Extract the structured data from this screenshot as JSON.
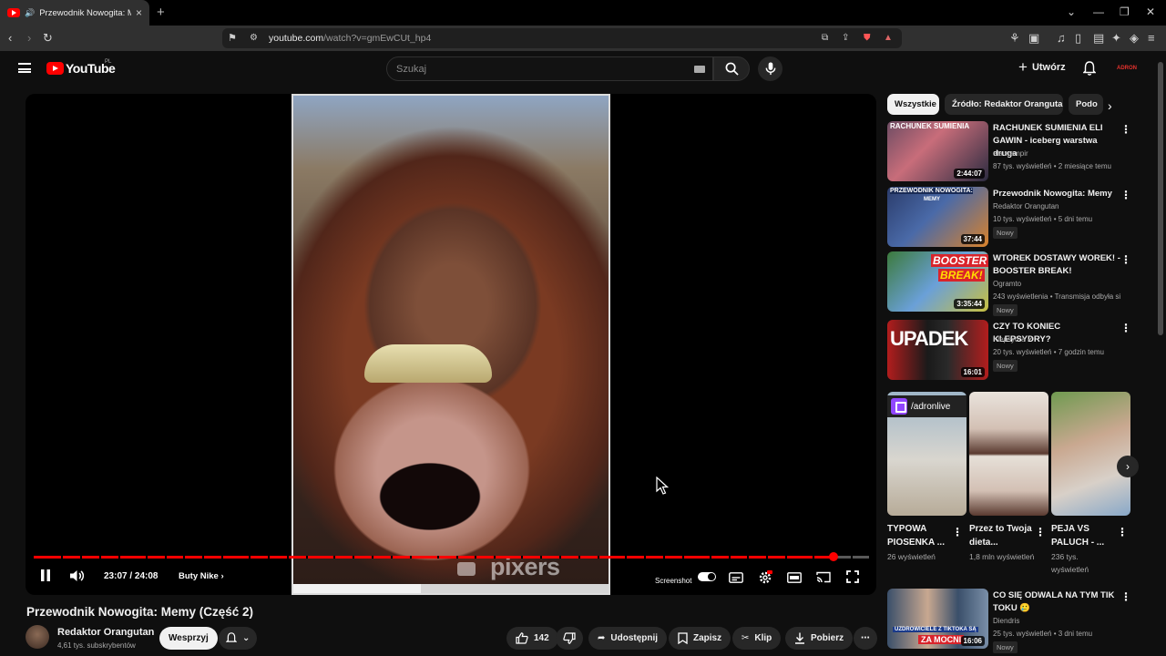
{
  "browser": {
    "tab_title": "Przewodnik Nowogita: Memy",
    "url_host": "youtube.com",
    "url_path": "/watch?v=gmEwCUt_hp4"
  },
  "header": {
    "logo_text": "YouTube",
    "logo_region": "PL",
    "search_placeholder": "Szukaj",
    "create_label": "Utwórz",
    "avatar_text": "ADRON"
  },
  "player": {
    "time": "23:07 / 24:08",
    "progress": 0.958,
    "chapter_label": "Buty Nike",
    "watermark": "pixers",
    "screenshot_label": "Screenshot",
    "accent_color": "#ff0000"
  },
  "video": {
    "title": "Przewodnik Nowogita: Memy (Część 2)",
    "channel": "Redaktor Orangutan",
    "subscribers": "4,61 tys. subskrybentów",
    "support_label": "Wesprzyj",
    "likes": "142",
    "share_label": "Udostępnij",
    "save_label": "Zapisz",
    "clip_label": "Klip",
    "download_label": "Pobierz"
  },
  "sidebar": {
    "chips": [
      "Wszystkie",
      "Źródło: Redaktor Orangutan",
      "Podo"
    ],
    "recommendations": [
      {
        "title": "RACHUNEK SUMIENIA ELI GAWIN - iceberg warstwa druga",
        "channel": "ela wampir",
        "meta": "87 tys. wyświetleń • 2 miesiące temu",
        "duration": "2:44:07",
        "badge": ""
      },
      {
        "title": "Przewodnik Nowogita: Memy",
        "channel": "Redaktor Orangutan",
        "meta": "10 tys. wyświetleń • 5 dni temu",
        "duration": "37:44",
        "badge": "Nowy"
      },
      {
        "title": "WTOREK DOSTAWY WOREK! - BOOSTER BREAK!",
        "channel": "Ogramto",
        "meta": "243 wyświetlenia • Transmisja odbyła się",
        "duration": "3:35:44",
        "badge": "Nowy"
      },
      {
        "title": "CZY TO KONIEC KLEPSYDRY?",
        "channel": "Klepsydra ✔",
        "meta": "20 tys. wyświetleń • 7 godzin temu",
        "duration": "16:01",
        "badge": "Nowy"
      }
    ],
    "shorts": [
      {
        "title": "TYPOWA PIOSENKA ...",
        "views": "26 wyświetleń",
        "tag": "/adronlive"
      },
      {
        "title": "Przez to Twoja dieta...",
        "views": "1,8 mln wyświetleń"
      },
      {
        "title": "PEJA VS PALUCH - ...",
        "views": "236 tys. wyświetleń"
      }
    ],
    "bottom_rec": {
      "title": "CO SIĘ ODWALA NA TYM TIK TOKU 🥲",
      "channel": "Diendris",
      "meta": "25 tys. wyświetleń • 3 dni temu",
      "duration": "16:06",
      "badge": "Nowy",
      "thumb_caption_1": "UZDROWICIELE Z TIKTOKA SĄ",
      "thumb_caption_2": "ZA MOCNI"
    },
    "thumb_text": {
      "r1": "RACHUNEK SUMIENIA",
      "r2a": "PRZEWODNIK NOWOGITA:",
      "r2b": "MEMY",
      "r3a": "BOOSTER",
      "r3b": "BREAK!",
      "r4": "UPADEK"
    }
  }
}
